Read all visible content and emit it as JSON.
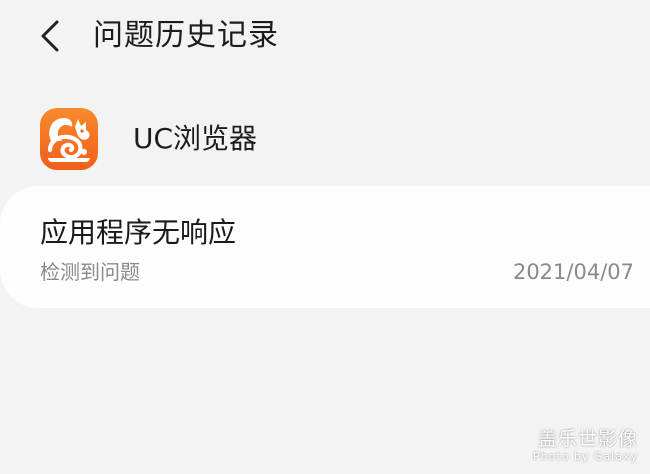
{
  "header": {
    "title": "问题历史记录",
    "back_icon": "chevron-left-icon"
  },
  "app": {
    "name": "UC浏览器",
    "icon": "uc-browser-squirrel-icon",
    "icon_color": "#f26d21"
  },
  "problems": [
    {
      "title": "应用程序无响应",
      "subtitle": "检测到问题",
      "date": "2021/04/07"
    }
  ],
  "watermark": {
    "main": "盖乐世影像",
    "sub": "Photo by Galaxy"
  },
  "colors": {
    "background": "#f3f3f3",
    "card": "#fdfdfd",
    "secondary_text": "#8a8a8a"
  }
}
